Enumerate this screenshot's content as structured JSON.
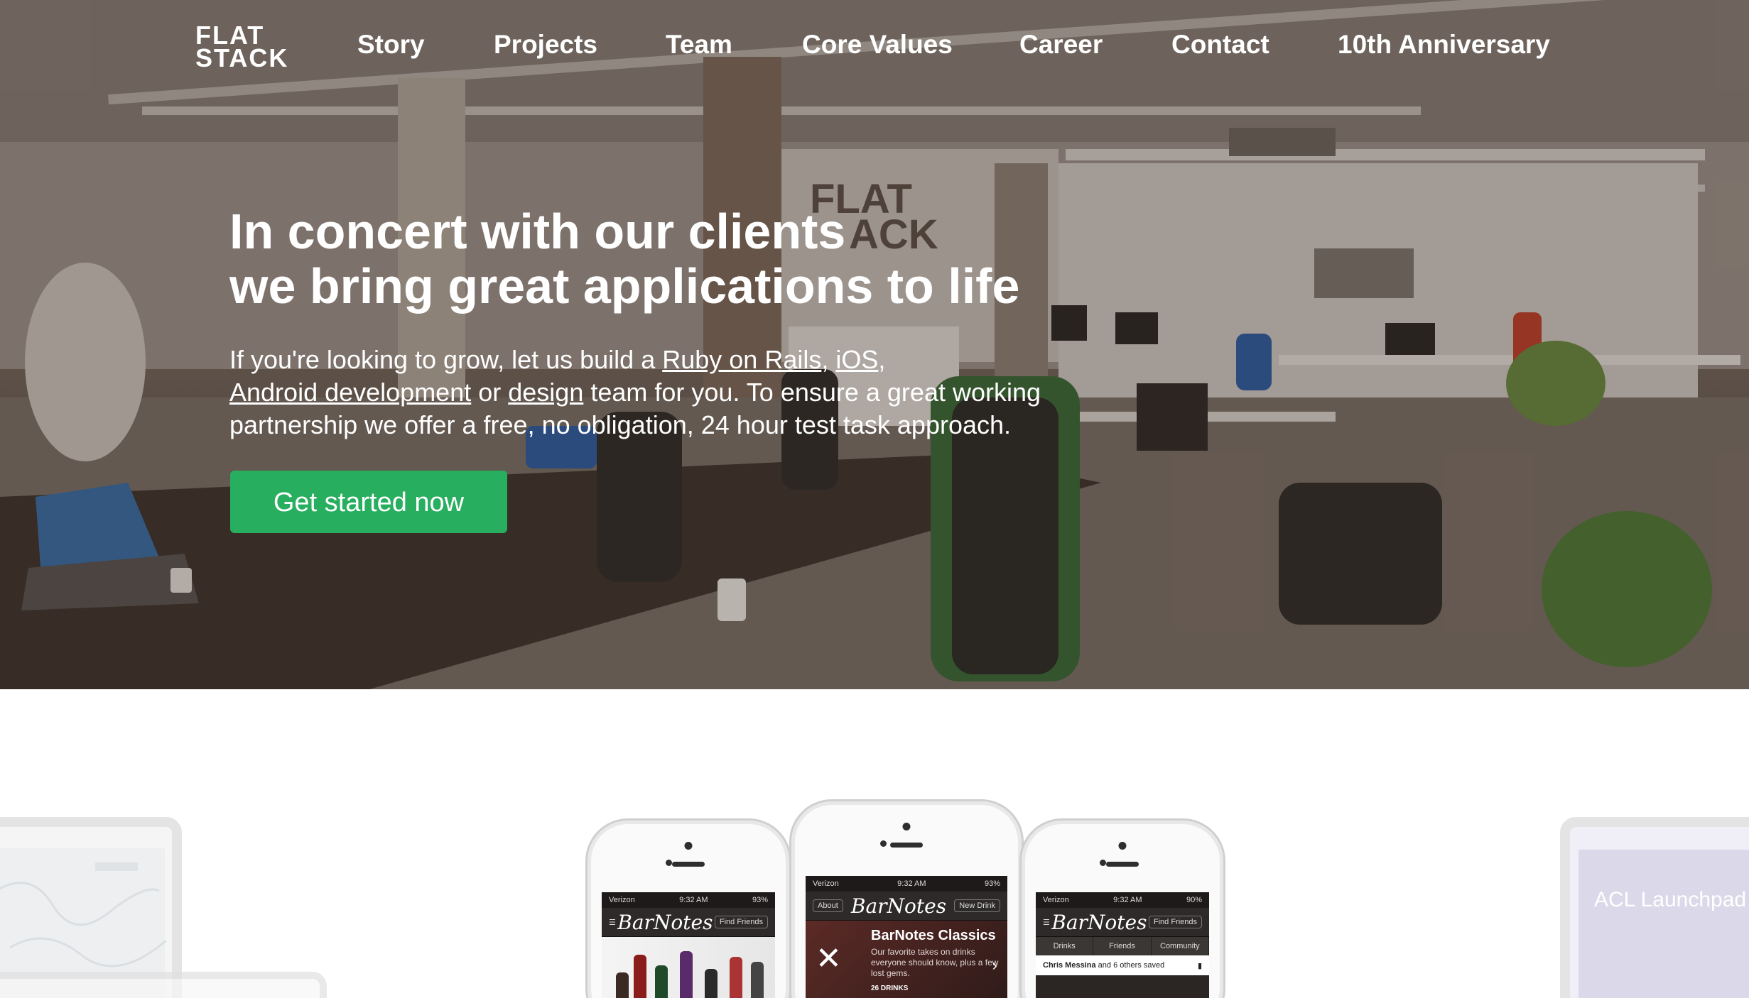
{
  "logo": {
    "line1": "FLAT",
    "line2": "STACK"
  },
  "nav": {
    "items": [
      "Story",
      "Projects",
      "Team",
      "Core Values",
      "Career",
      "Contact",
      "10th Anniversary"
    ]
  },
  "hero": {
    "wall_logo_line1": "FLAT",
    "wall_logo_line2": "ACK",
    "headline_line1": "In concert with our clients",
    "headline_line2": "we bring great applications to life",
    "lead_part1": "If you're looking to grow, let us build a ",
    "link_ruby": "Ruby on Rails",
    "lead_comma1": ", ",
    "link_ios": "iOS",
    "lead_comma2": ",",
    "link_android": "Android development",
    "lead_or": " or ",
    "link_design": "design",
    "lead_part2": " team for you. To ensure a great working partnership we offer a free, no obligation, 24 hour test task approach.",
    "cta_label": "Get started now"
  },
  "showcase": {
    "right_laptop_title": "ACL Launchpad",
    "phone_left": {
      "carrier": "Verizon",
      "time": "9:32 AM",
      "battery": "93%",
      "brand": "BarNotes",
      "right_button": "Find Friends"
    },
    "phone_center": {
      "carrier": "Verizon",
      "time": "9:32 AM",
      "battery": "93%",
      "brand": "BarNotes",
      "left_button": "About",
      "right_button": "New Drink",
      "feature_title": "BarNotes Classics",
      "feature_text": "Our favorite takes on drinks everyone should know, plus a few lost gems.",
      "feature_count": "26 DRINKS"
    },
    "phone_right": {
      "carrier": "Verizon",
      "time": "9:32 AM",
      "battery": "90%",
      "brand": "BarNotes",
      "right_button": "Find Friends",
      "tabs": [
        "Drinks",
        "Friends",
        "Community"
      ],
      "feed_user": "Chris Messina",
      "feed_text": "and 6 others saved"
    }
  },
  "colors": {
    "cta": "#27ae5f",
    "text_on_hero": "#ffffff"
  }
}
